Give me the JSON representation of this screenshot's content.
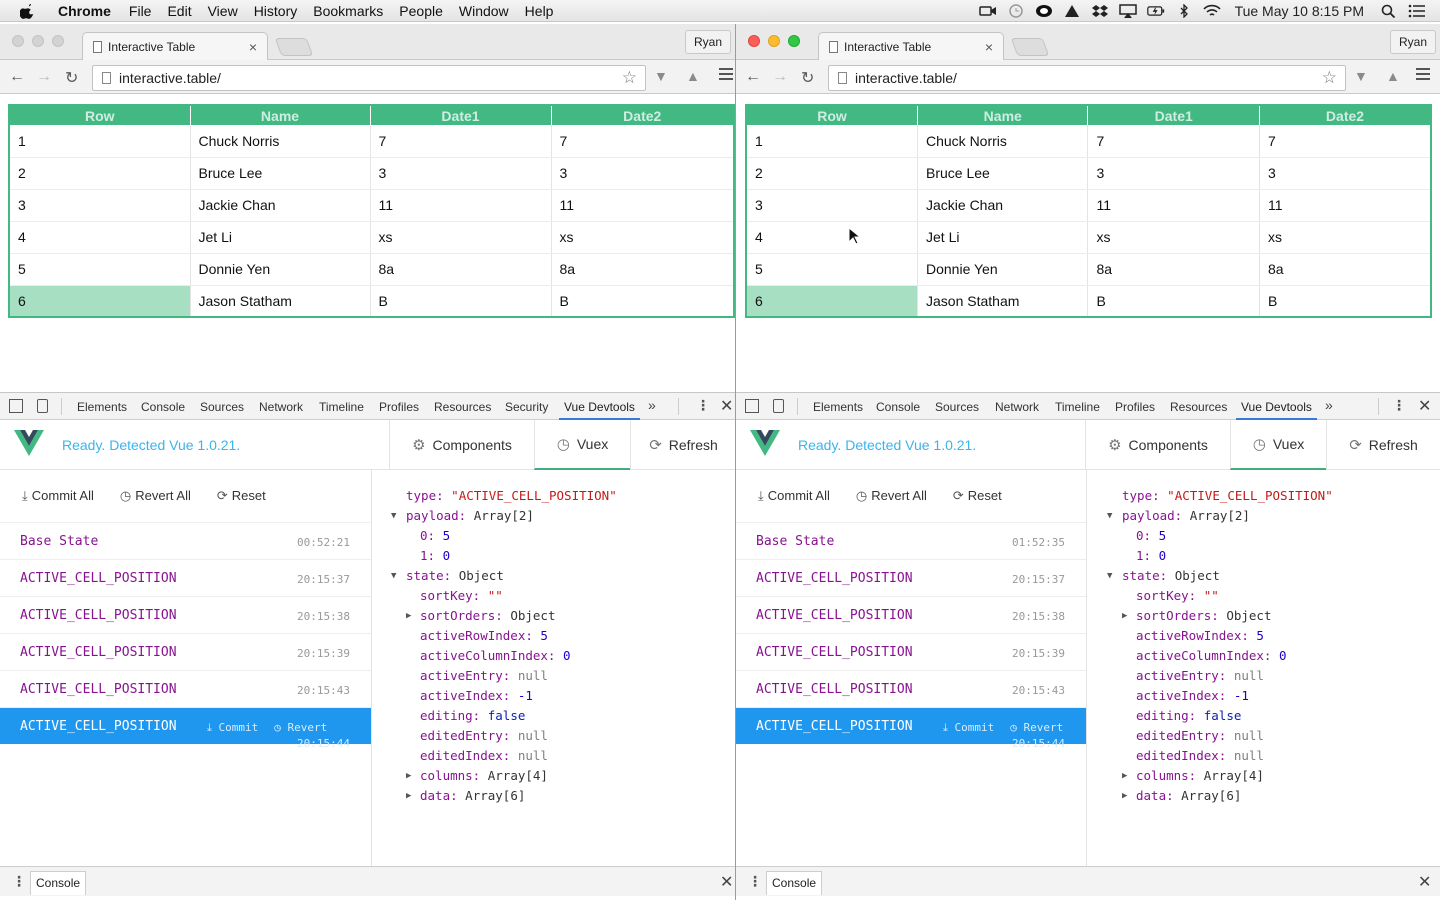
{
  "menubar": {
    "app": "Chrome",
    "items": [
      "File",
      "Edit",
      "View",
      "History",
      "Bookmarks",
      "People",
      "Window",
      "Help"
    ],
    "clock": "Tue May 10  8:15 PM"
  },
  "browser": {
    "tab_title": "Interactive Table",
    "url": "interactive.table/",
    "profile": "Ryan"
  },
  "table": {
    "headers": [
      "Row",
      "Name",
      "Date1",
      "Date2"
    ],
    "rows": [
      [
        "1",
        "Chuck Norris",
        "7",
        "7"
      ],
      [
        "2",
        "Bruce Lee",
        "3",
        "3"
      ],
      [
        "3",
        "Jackie Chan",
        "11",
        "11"
      ],
      [
        "4",
        "Jet Li",
        "xs",
        "xs"
      ],
      [
        "5",
        "Donnie Yen",
        "8a",
        "8a"
      ],
      [
        "6",
        "Jason Statham",
        "B",
        "B"
      ]
    ],
    "active_row_index": 5,
    "active_column_index": 0
  },
  "devtools": {
    "tabs": [
      "Elements",
      "Console",
      "Sources",
      "Network",
      "Timeline",
      "Profiles",
      "Resources",
      "Security",
      "Vue Devtools"
    ],
    "tabs_right": [
      "Elements",
      "Console",
      "Sources",
      "Network",
      "Timeline",
      "Profiles",
      "Resources",
      "Vue Devtools"
    ],
    "active_tab": "Vue Devtools",
    "drawer_tab": "Console"
  },
  "vue": {
    "status": "Ready. Detected Vue 1.0.21.",
    "buttons": [
      "Components",
      "Vuex",
      "Refresh"
    ],
    "active_button": "Vuex",
    "actions": [
      "Commit All",
      "Revert All",
      "Reset"
    ],
    "base_state_label": "Base State",
    "base_time_left": "00:52:21",
    "base_time_right": "01:52:35",
    "mutations": [
      {
        "name": "ACTIVE_CELL_POSITION",
        "time": "20:15:37"
      },
      {
        "name": "ACTIVE_CELL_POSITION",
        "time": "20:15:38"
      },
      {
        "name": "ACTIVE_CELL_POSITION",
        "time": "20:15:39"
      },
      {
        "name": "ACTIVE_CELL_POSITION",
        "time": "20:15:43"
      },
      {
        "name": "ACTIVE_CELL_POSITION",
        "time": "20:15:44"
      }
    ],
    "selected_actions": [
      "Commit",
      "Revert"
    ]
  },
  "state_inspector": {
    "type_key": "type:",
    "type_value": "\"ACTIVE_CELL_POSITION\"",
    "payload_key": "payload:",
    "payload_value": "Array[2]",
    "payload_items": [
      {
        "k": "0:",
        "v": "5"
      },
      {
        "k": "1:",
        "v": "0"
      }
    ],
    "state_key": "state:",
    "state_value": "Object",
    "state_fields": [
      {
        "k": "sortKey:",
        "v": "\"\"",
        "kind": "s",
        "expandable": false
      },
      {
        "k": "sortOrders:",
        "v": "Object",
        "kind": "t",
        "expandable": true
      },
      {
        "k": "activeRowIndex:",
        "v": "5",
        "kind": "n",
        "expandable": false
      },
      {
        "k": "activeColumnIndex:",
        "v": "0",
        "kind": "n",
        "expandable": false
      },
      {
        "k": "activeEntry:",
        "v": "null",
        "kind": "nl",
        "expandable": false
      },
      {
        "k": "activeIndex:",
        "v": "-1",
        "kind": "n",
        "expandable": false
      },
      {
        "k": "editing:",
        "v": "false",
        "kind": "b",
        "expandable": false
      },
      {
        "k": "editedEntry:",
        "v": "null",
        "kind": "nl",
        "expandable": false
      },
      {
        "k": "editedIndex:",
        "v": "null",
        "kind": "nl",
        "expandable": false
      }
    ],
    "extra_fields": [
      {
        "k": "columns:",
        "v": "Array[4]"
      },
      {
        "k": "data:",
        "v": "Array[6]"
      }
    ]
  },
  "colors": {
    "accent": "#42b983",
    "active_cell": "#a7dfc2",
    "selected_mutation": "#1f97ef",
    "vue_status": "#3bb4ea"
  }
}
